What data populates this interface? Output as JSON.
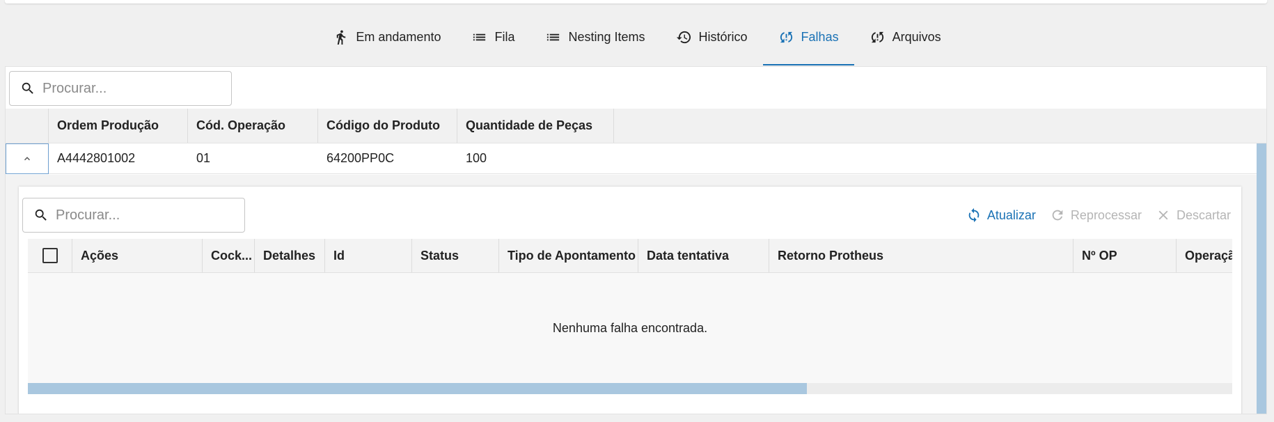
{
  "tabs": [
    {
      "label": "Em andamento",
      "icon": "running-person-icon",
      "active": false
    },
    {
      "label": "Fila",
      "icon": "list-icon",
      "active": false
    },
    {
      "label": "Nesting Items",
      "icon": "list-icon",
      "active": false
    },
    {
      "label": "Histórico",
      "icon": "history-icon",
      "active": false
    },
    {
      "label": "Falhas",
      "icon": "sync-problem-icon",
      "active": true
    },
    {
      "label": "Arquivos",
      "icon": "sync-problem-icon",
      "active": false
    }
  ],
  "outer_search": {
    "placeholder": "Procurar..."
  },
  "outer_table": {
    "columns": [
      "Ordem Produção",
      "Cód. Operação",
      "Código do Produto",
      "Quantidade de Peças"
    ],
    "rows": [
      {
        "ordem": "A4442801002",
        "operacao": "01",
        "produto": "64200PP0C",
        "quantidade": "100"
      }
    ]
  },
  "inner_search": {
    "placeholder": "Procurar..."
  },
  "actions": {
    "refresh": "Atualizar",
    "reprocess": "Reprocessar",
    "discard": "Descartar"
  },
  "inner_table": {
    "columns": [
      "Ações",
      "Cock...",
      "Detalhes",
      "Id",
      "Status",
      "Tipo de Apontamento",
      "Data tentativa",
      "Retorno Protheus",
      "Nº OP",
      "Operaçã"
    ],
    "empty_message": "Nenhuma falha encontrada.",
    "horizontal_scroll_fraction": 0.647
  },
  "colors": {
    "accent": "#1a72b5",
    "disabled": "#b5b5b5",
    "scrollbar": "#a9c7df"
  }
}
